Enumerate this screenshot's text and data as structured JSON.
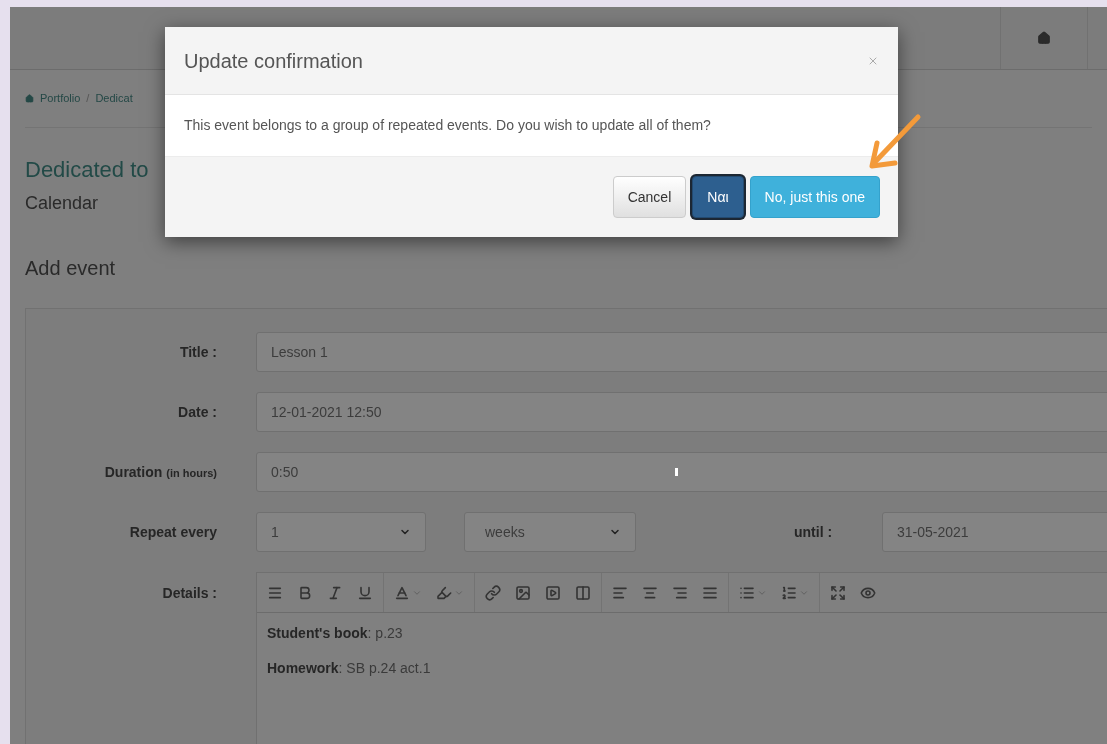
{
  "breadcrumb": [
    "Portfolio",
    "Dedicat"
  ],
  "breadcrumb_separator": "/",
  "page_title": "Dedicated to",
  "page_subtitle": "Calendar",
  "section_title": "Add event",
  "form": {
    "fields": [
      {
        "label": "Title :",
        "value": "Lesson 1"
      },
      {
        "label": "Date :",
        "value": "12-01-2021 12:50"
      },
      {
        "label": "Duration",
        "label_note": "(in hours)",
        "value": "0:50"
      }
    ],
    "repeat": {
      "label": "Repeat every",
      "count": "1",
      "unit": "weeks",
      "until_label": "until :",
      "until": "31-05-2021"
    },
    "details": {
      "label": "Details :",
      "lines": [
        "**Student's book**: p.23",
        "**Homework**: SB p.24 act.1"
      ]
    }
  },
  "dialog": {
    "title": "Update confirmation",
    "message": "This event belongs to a group of repeated events. Do you wish to update all of them?",
    "buttons": [
      {
        "label": "Cancel",
        "kind": "default",
        "focused": false
      },
      {
        "label": "Ναι",
        "kind": "primary",
        "focused": true
      },
      {
        "label": "No, just this one",
        "kind": "info",
        "focused": false
      }
    ]
  }
}
